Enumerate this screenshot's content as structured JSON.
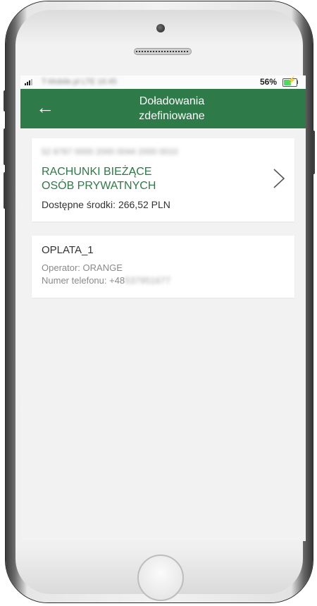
{
  "status_bar": {
    "carrier": "T-Mobile.pl LTE 16:45",
    "battery_percent": "56%",
    "battery_level": 0.56,
    "battery_charging": true
  },
  "header": {
    "title_line1": "Doładowania",
    "title_line2": "zdefiniowane"
  },
  "account_card": {
    "account_number": "52 8787 0000 2000 0044 2000 0010",
    "name_line1": "RACHUNKI BIEŻĄCE",
    "name_line2": "OSÓB PRYWATNYCH",
    "funds_label": "Dostępne środki: 266,52 PLN"
  },
  "topup_card": {
    "name": "OPLATA_1",
    "operator_label": "Operator: ORANGE",
    "phone_label": "Numer telefonu: +48",
    "phone_masked": "537951677"
  },
  "colors": {
    "header_bg": "#2e7a48",
    "accent_text": "#2f7a47",
    "screen_bg": "#f2f2f2"
  },
  "icons": {
    "back": "back-arrow-icon",
    "chevron": "chevron-right-icon",
    "battery": "battery-icon",
    "signal": "signal-icon"
  }
}
